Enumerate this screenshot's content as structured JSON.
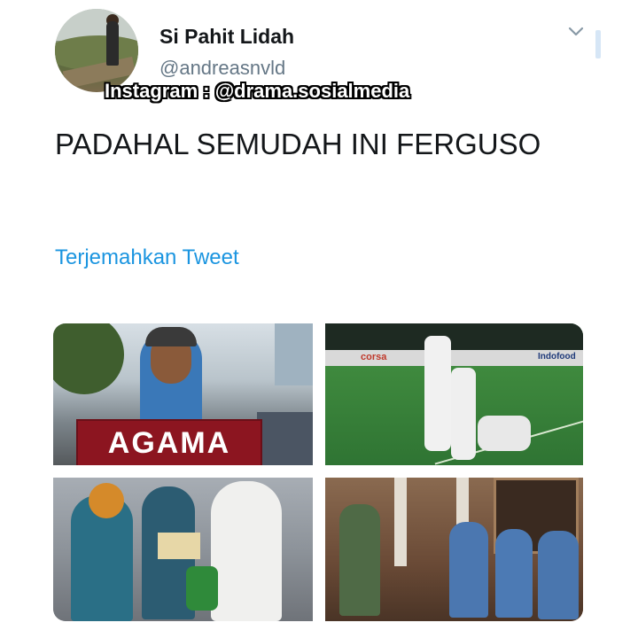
{
  "tweet": {
    "display_name": "Si Pahit Lidah",
    "handle": "@andreasnvld",
    "watermark": "Instagram : @drama.sosialmedia",
    "text": "PADAHAL SEMUDAH INI FERGUSO",
    "translate_label": "Terjemahkan Tweet"
  },
  "media": {
    "photo1_sign": "AGAMA",
    "photo2_ad_left": "corsa",
    "photo2_ad_right": "Indofood"
  },
  "icons": {
    "menu": "chevron-down-icon"
  },
  "colors": {
    "link": "#1b95e0",
    "handle": "#657786",
    "sign": "#8c1520"
  }
}
